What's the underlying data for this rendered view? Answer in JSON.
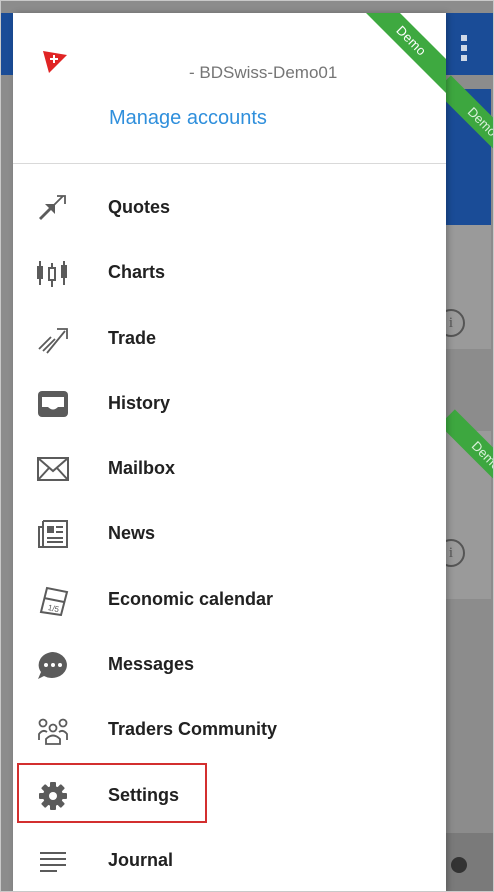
{
  "drawer": {
    "demo_badge": "Demo",
    "account_name": "- BDSwiss-Demo01",
    "manage_accounts": "Manage accounts",
    "menu": [
      {
        "label": "Quotes",
        "icon": "quotes-icon"
      },
      {
        "label": "Charts",
        "icon": "charts-icon"
      },
      {
        "label": "Trade",
        "icon": "trade-icon"
      },
      {
        "label": "History",
        "icon": "history-icon"
      },
      {
        "label": "Mailbox",
        "icon": "mailbox-icon"
      },
      {
        "label": "News",
        "icon": "news-icon"
      },
      {
        "label": "Economic calendar",
        "icon": "calendar-icon"
      },
      {
        "label": "Messages",
        "icon": "messages-icon"
      },
      {
        "label": "Traders Community",
        "icon": "community-icon"
      },
      {
        "label": "Settings",
        "icon": "gear-icon",
        "highlighted": true
      },
      {
        "label": "Journal",
        "icon": "journal-icon"
      }
    ]
  },
  "background": {
    "badges": [
      "Demo",
      "Demo"
    ],
    "info_glyph": "i"
  },
  "colors": {
    "accent_link": "#2f8fdc",
    "demo_green": "#3ea940",
    "highlight_border": "#d32f2f",
    "app_blue": "#1a4c97"
  }
}
